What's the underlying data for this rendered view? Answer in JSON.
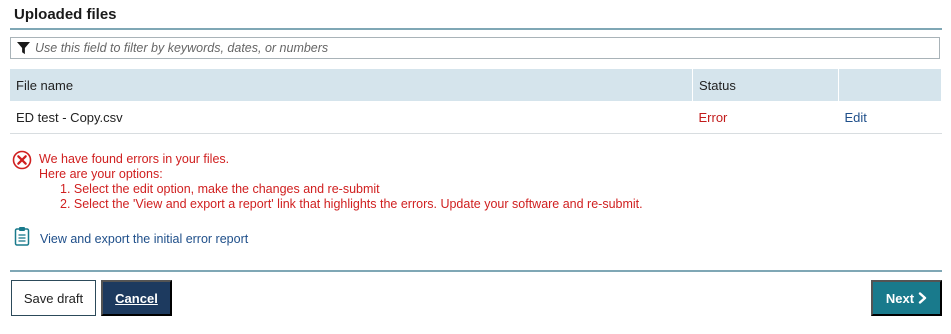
{
  "section": {
    "title": "Uploaded files"
  },
  "filter": {
    "placeholder": "Use this field to filter by keywords, dates, or numbers",
    "icon": "filter-icon"
  },
  "table": {
    "columns": [
      "File name",
      "Status",
      ""
    ],
    "rows": [
      {
        "file_name": "ED test - Copy.csv",
        "status": "Error",
        "action": "Edit"
      }
    ]
  },
  "errors": {
    "icon": "error-circle-icon",
    "heading": "We have found errors in your files.",
    "subheading": "Here are your options:",
    "options": [
      "1. Select the edit option, make the changes and re-submit",
      "2. Select the 'View and export a report' link that highlights the errors. Update your software and re-submit."
    ]
  },
  "report": {
    "icon": "clipboard-icon",
    "label": "View and export the initial error report"
  },
  "buttons": {
    "save_draft": "Save draft",
    "cancel": "Cancel",
    "next": "Next"
  },
  "colors": {
    "error": "#d02020",
    "link": "#1f4f8a",
    "header_bg": "#d5e4ec",
    "primary": "#1d3a5f",
    "next": "#197a8c",
    "rule": "#7fa7b5"
  }
}
